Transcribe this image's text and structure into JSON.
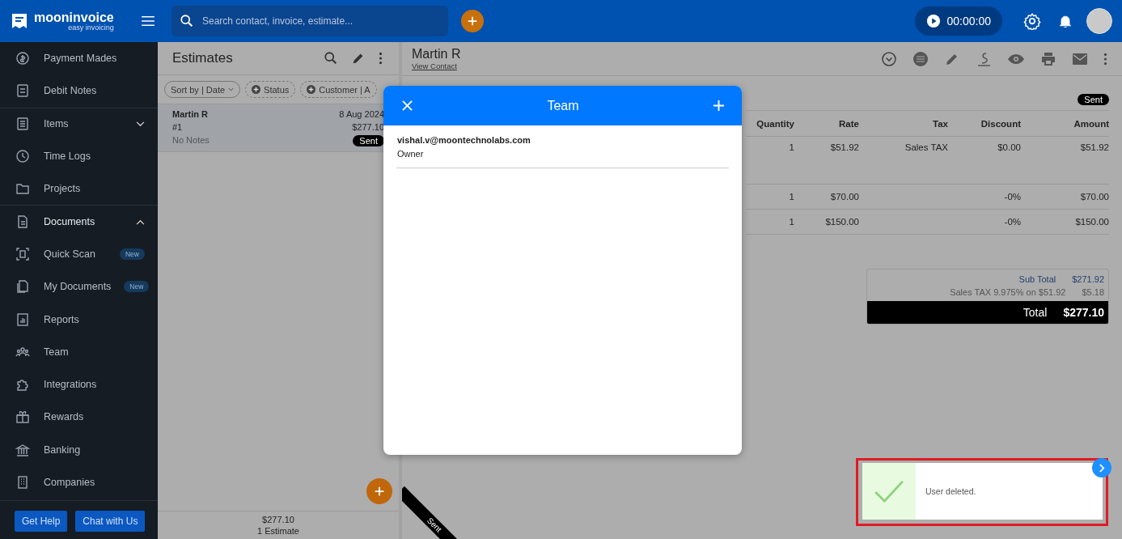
{
  "topbar": {
    "logo_name": "mooninvoice",
    "logo_tagline": "easy invoicing",
    "search": {
      "placeholder": "Search contact, invoice, estimate..."
    },
    "timer": "00:00:00"
  },
  "sidebar": {
    "items": [
      {
        "label": "Payment Mades"
      },
      {
        "label": "Debit Notes"
      },
      {
        "label": "Items",
        "expanded": false
      },
      {
        "label": "Time Logs"
      },
      {
        "label": "Projects"
      },
      {
        "label": "Documents",
        "expanded": true,
        "children": [
          {
            "label": "Quick Scan",
            "badge": "New"
          },
          {
            "label": "My Documents",
            "badge": "New"
          }
        ]
      },
      {
        "label": "Reports"
      },
      {
        "label": "Team"
      },
      {
        "label": "Integrations"
      },
      {
        "label": "Rewards"
      },
      {
        "label": "Banking"
      },
      {
        "label": "Companies"
      }
    ],
    "buttons": [
      "Get Help",
      "Chat with Us"
    ]
  },
  "list_panel": {
    "title": "Estimates",
    "filters": [
      "Sort by | Date",
      "Status",
      "Customer | A"
    ],
    "items": [
      {
        "customer": "Martin R",
        "date": "8 Aug 2024",
        "number": "#1",
        "amount": "$277.10",
        "notes": "No Notes",
        "status": "Sent",
        "selected": true
      }
    ],
    "footer_total": "$277.10",
    "footer_count": "1 Estimate"
  },
  "detail": {
    "customer": "Martin R",
    "link": "View Contact",
    "status": "Sent",
    "ribbon": "Sent",
    "columns": [
      "Quantity",
      "Rate",
      "Tax",
      "Discount",
      "Amount"
    ],
    "rows": [
      [
        "1",
        "$51.92",
        "Sales TAX",
        "$0.00",
        "$51.92"
      ],
      [
        "1",
        "$70.00",
        "",
        "-0%",
        "$70.00"
      ],
      [
        "1",
        "$150.00",
        "",
        "-0%",
        "$150.00"
      ]
    ],
    "totals": [
      {
        "label": "Sub Total",
        "value": "$271.92",
        "kind": "sub"
      },
      {
        "label": "Sales TAX 9.975% on $51.92",
        "value": "$5.18",
        "kind": "tax"
      },
      {
        "label": "Total",
        "value": "$277.10",
        "kind": "grand"
      }
    ]
  },
  "dialog": {
    "title": "Team",
    "members": [
      {
        "email": "vishal.v@moontechnolabs.com",
        "role": "Owner"
      }
    ]
  },
  "toast": {
    "message": "User deleted."
  }
}
